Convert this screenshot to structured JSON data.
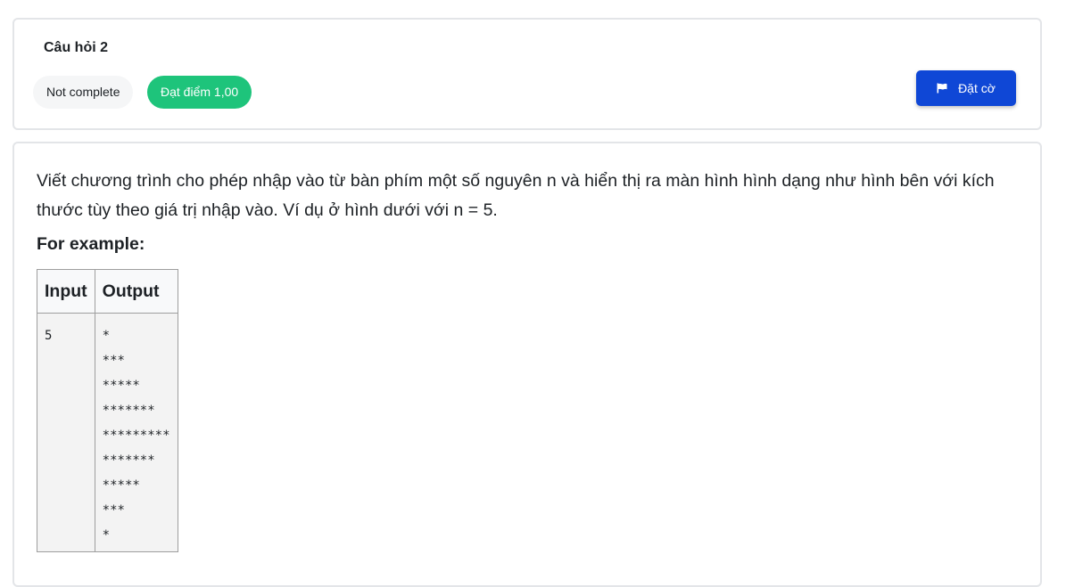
{
  "question": {
    "title": "Câu hỏi 2",
    "status": "Not complete",
    "grade": "Đạt điểm 1,00",
    "flag_label": "Đặt cờ"
  },
  "content": {
    "text": "Viết chương trình cho phép nhập vào từ bàn phím một số nguyên n và hiển thị ra màn hình hình dạng như hình bên với kích thước tùy theo giá trị nhập vào. Ví dụ ở hình dưới với n = 5.",
    "example_heading": "For example:",
    "table": {
      "headers": [
        "Input",
        "Output"
      ],
      "input": "5",
      "output": "*\n***\n*****\n*******\n*********\n*******\n*****\n***\n*"
    }
  },
  "colors": {
    "grade_badge": "#1ec47b",
    "flag_button": "#0f47d6",
    "status_badge": "#f5f6f7"
  },
  "icons": {
    "flag": "flag-icon"
  }
}
